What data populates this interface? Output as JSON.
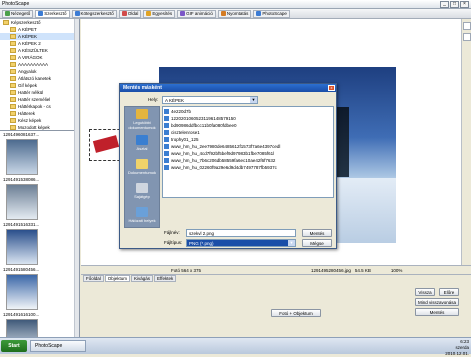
{
  "app": {
    "title": "PhotoScape",
    "window_controls": [
      "_",
      "□",
      "×"
    ]
  },
  "tabs": [
    {
      "label": "Nézegető",
      "color": "#4aa04a"
    },
    {
      "label": "Szerkesztő",
      "color": "#3b7bd4"
    },
    {
      "label": "Kötegszerkesztő",
      "color": "#3b7bd4"
    },
    {
      "label": "Oldal",
      "color": "#d14b4b"
    },
    {
      "label": "Egyesítés",
      "color": "#e0a325"
    },
    {
      "label": "GIF animáció",
      "color": "#7b57c8"
    },
    {
      "label": "Nyomtatás",
      "color": "#d47b23"
    },
    {
      "label": "PhotoScape",
      "color": "#3b7bd4"
    }
  ],
  "tree": [
    {
      "label": "Képszerkesztő"
    },
    {
      "label": "A KÉPET"
    },
    {
      "label": "A KÉPEK",
      "selected": true
    },
    {
      "label": "A KÉPEK 2"
    },
    {
      "label": "A KÉSZÜLTEK"
    },
    {
      "label": "A VIRÁGOK"
    },
    {
      "label": "AAAAAAAAAA"
    },
    {
      "label": "Angyalok"
    },
    {
      "label": "Átlátszó kanetek"
    },
    {
      "label": "Gif képek"
    },
    {
      "label": "Hattér nélkül"
    },
    {
      "label": "Hattér személiel"
    },
    {
      "label": "Háttérkapok - cs"
    },
    {
      "label": "Hátterek"
    },
    {
      "label": "Kész képek"
    },
    {
      "label": "Mozodott képek"
    }
  ],
  "thumbnails": [
    {
      "caption": "1291496081637...",
      "colors": [
        "#4d6b8f",
        "#c8d6e6"
      ]
    },
    {
      "caption": "1291491538086...",
      "colors": [
        "#6c7f95",
        "#e4ebf2"
      ]
    },
    {
      "caption": "1291491516331...",
      "colors": [
        "#2a4f8c",
        "#d9e4f1"
      ]
    },
    {
      "caption": "1291491580456...",
      "colors": [
        "#3b67a8",
        "#f0f4f8"
      ]
    },
    {
      "caption": "1291491616100...",
      "colors": [
        "#405a7a",
        "#e5ebf1"
      ]
    }
  ],
  "dialog": {
    "title": "Mentés másként",
    "close": "x",
    "location_label": "Hely:",
    "location_value": "A KÉPEK",
    "places": [
      {
        "label": "Legutóbbi dokumentumok",
        "color": "#e5b53f"
      },
      {
        "label": "Asztal",
        "color": "#3a7fd1"
      },
      {
        "label": "Dokumentumok",
        "color": "#f0d36a"
      },
      {
        "label": "Sajátgép",
        "color": "#cfd6df"
      },
      {
        "label": "Hálózati helyek",
        "color": "#6aa0d9"
      }
    ],
    "files": [
      {
        "name": "4e220d7b",
        "color": "#3a7fd1"
      },
      {
        "name": "12202010605231196148579150",
        "color": "#3a7fd1"
      },
      {
        "name": "bd90986ddfbcc11b0fa080fdbee0",
        "color": "#3a7fd1"
      },
      {
        "name": "cisztelenrose1",
        "color": "#3a7fd1"
      },
      {
        "name": "trophy01_125",
        "color": "#3a7fd1"
      },
      {
        "name": "www_hm_hu_2ee7980de6485612f1573f7a6e4397cedl",
        "color": "#3a7fd1"
      },
      {
        "name": "www_hm_hu_4cd7f92bf5bef9d97983b1fbe7085f61l",
        "color": "#3a7fd1"
      },
      {
        "name": "www_hm_hu_7b6c206db58559fa6ec10ae42f6f7632",
        "color": "#3a7fd1"
      },
      {
        "name": "www_hm_hu_02260f9a29e6d9d4db7497787fb5937c",
        "color": "#3a7fd1"
      }
    ],
    "filename_label": "Fájlnév:",
    "filename_value": "szekvl 2.png",
    "filetype_label": "Fájltípus:",
    "filetype_value": "PNG (*.png)",
    "save_button": "Mentés",
    "cancel_button": "Mégse"
  },
  "status": {
    "size": "Fotó 564 x 375",
    "filename": "1291495280456.jpg",
    "filesize": "54.5 KB",
    "zoom": "100%"
  },
  "bottom_tabs": [
    "Főoldal",
    "Objektum",
    "Kivágás",
    "Effektek"
  ],
  "bottom_buttons": {
    "photo_object": "Fotó + Objektum",
    "undo": "Vissza",
    "redo": "Előre",
    "undo_all": "Mind visszavonása",
    "save": "Mentés"
  },
  "taskbar": {
    "start": "Start",
    "task": "PhotoScape",
    "clock_time": "6:23",
    "clock_day": "szerda",
    "clock_date": "2010.12.01."
  }
}
